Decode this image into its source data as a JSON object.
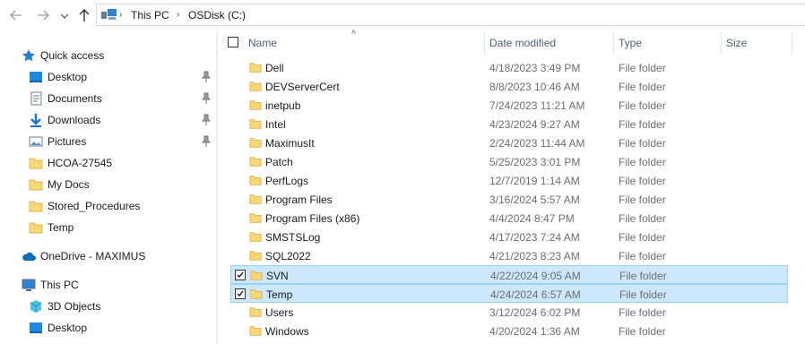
{
  "address_bar": {
    "crumbs": [
      "This PC",
      "OSDisk (C:)"
    ]
  },
  "nav_pane": {
    "items": [
      {
        "label": "Quick access",
        "icon": "star-icon"
      },
      {
        "label": "Desktop",
        "icon": "desktop-icon",
        "pinned": true
      },
      {
        "label": "Documents",
        "icon": "documents-icon",
        "pinned": true
      },
      {
        "label": "Downloads",
        "icon": "download-arrow-icon",
        "pinned": true
      },
      {
        "label": "Pictures",
        "icon": "pictures-icon",
        "pinned": true
      },
      {
        "label": "HCOA-27545",
        "icon": "folder-icon"
      },
      {
        "label": "My Docs",
        "icon": "folder-icon"
      },
      {
        "label": "Stored_Procedures",
        "icon": "folder-icon"
      },
      {
        "label": "Temp",
        "icon": "folder-icon"
      },
      {
        "label": "OneDrive - MAXIMUS",
        "icon": "cloud-icon"
      },
      {
        "label": "This PC",
        "icon": "computer-icon"
      },
      {
        "label": "3D Objects",
        "icon": "cube-icon"
      },
      {
        "label": "Desktop",
        "icon": "desktop-icon"
      }
    ]
  },
  "list": {
    "columns": {
      "name": "Name",
      "date": "Date modified",
      "type": "Type",
      "size": "Size"
    },
    "rows": [
      {
        "name": "Dell",
        "date": "4/18/2023 3:49 PM",
        "type": "File folder"
      },
      {
        "name": "DEVServerCert",
        "date": "8/8/2023 10:46 AM",
        "type": "File folder"
      },
      {
        "name": "inetpub",
        "date": "7/24/2023 11:21 AM",
        "type": "File folder"
      },
      {
        "name": "Intel",
        "date": "4/23/2024 9:27 AM",
        "type": "File folder"
      },
      {
        "name": "MaximusIt",
        "date": "2/24/2023 11:44 AM",
        "type": "File folder"
      },
      {
        "name": "Patch",
        "date": "5/25/2023 3:01 PM",
        "type": "File folder"
      },
      {
        "name": "PerfLogs",
        "date": "12/7/2019 1:14 AM",
        "type": "File folder"
      },
      {
        "name": "Program Files",
        "date": "3/16/2024 5:57 AM",
        "type": "File folder"
      },
      {
        "name": "Program Files (x86)",
        "date": "4/4/2024 8:47 PM",
        "type": "File folder"
      },
      {
        "name": "SMSTSLog",
        "date": "4/17/2023 7:24 AM",
        "type": "File folder"
      },
      {
        "name": "SQL2022",
        "date": "4/21/2023 8:23 AM",
        "type": "File folder"
      },
      {
        "name": "SVN",
        "date": "4/22/2024 9:05 AM",
        "type": "File folder",
        "selected": true
      },
      {
        "name": "Temp",
        "date": "4/24/2024 6:57 AM",
        "type": "File folder",
        "selected": true
      },
      {
        "name": "Users",
        "date": "3/12/2024 6:02 PM",
        "type": "File folder"
      },
      {
        "name": "Windows",
        "date": "4/20/2024 1:36 AM",
        "type": "File folder"
      }
    ]
  },
  "colors": {
    "selection_bg": "#cce8ff",
    "selection_border": "#99d1ff",
    "folder": "#f8d775",
    "accent": "#0078d7"
  }
}
